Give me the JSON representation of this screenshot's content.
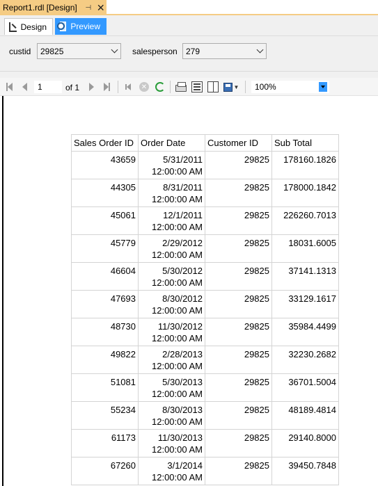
{
  "document_tab": {
    "title": "Report1.rdl [Design]",
    "pin_glyph": "⊣",
    "close_glyph": "✕"
  },
  "view_tabs": {
    "design": "Design",
    "preview": "Preview"
  },
  "parameters": {
    "custid": {
      "label": "custid",
      "value": "29825"
    },
    "salesperson": {
      "label": "salesperson",
      "value": "279"
    }
  },
  "toolbar": {
    "page": "1",
    "of_text": "of 1",
    "zoom": "100%"
  },
  "report": {
    "headers": [
      "Sales Order ID",
      "Order Date",
      "Customer ID",
      "Sub Total"
    ],
    "rows": [
      [
        "43659",
        "5/31/2011",
        "12:00:00 AM",
        "29825",
        "178160.1826"
      ],
      [
        "44305",
        "8/31/2011",
        "12:00:00 AM",
        "29825",
        "178000.1842"
      ],
      [
        "45061",
        "12/1/2011",
        "12:00:00 AM",
        "29825",
        "226260.7013"
      ],
      [
        "45779",
        "2/29/2012",
        "12:00:00 AM",
        "29825",
        "18031.6005"
      ],
      [
        "46604",
        "5/30/2012",
        "12:00:00 AM",
        "29825",
        "37141.1313"
      ],
      [
        "47693",
        "8/30/2012",
        "12:00:00 AM",
        "29825",
        "33129.1617"
      ],
      [
        "48730",
        "11/30/2012",
        "12:00:00 AM",
        "29825",
        "35984.4499"
      ],
      [
        "49822",
        "2/28/2013",
        "12:00:00 AM",
        "29825",
        "32230.2682"
      ],
      [
        "51081",
        "5/30/2013",
        "12:00:00 AM",
        "29825",
        "36701.5004"
      ],
      [
        "55234",
        "8/30/2013",
        "12:00:00 AM",
        "29825",
        "48189.4814"
      ],
      [
        "61173",
        "11/30/2013",
        "12:00:00 AM",
        "29825",
        "29140.8000"
      ],
      [
        "67260",
        "3/1/2014",
        "12:00:00 AM",
        "29825",
        "39450.7848"
      ]
    ]
  },
  "colors": {
    "doc_tab": "#f5cc84",
    "preview_tab": "#3399ff",
    "chrome": "#f0f0f0"
  }
}
